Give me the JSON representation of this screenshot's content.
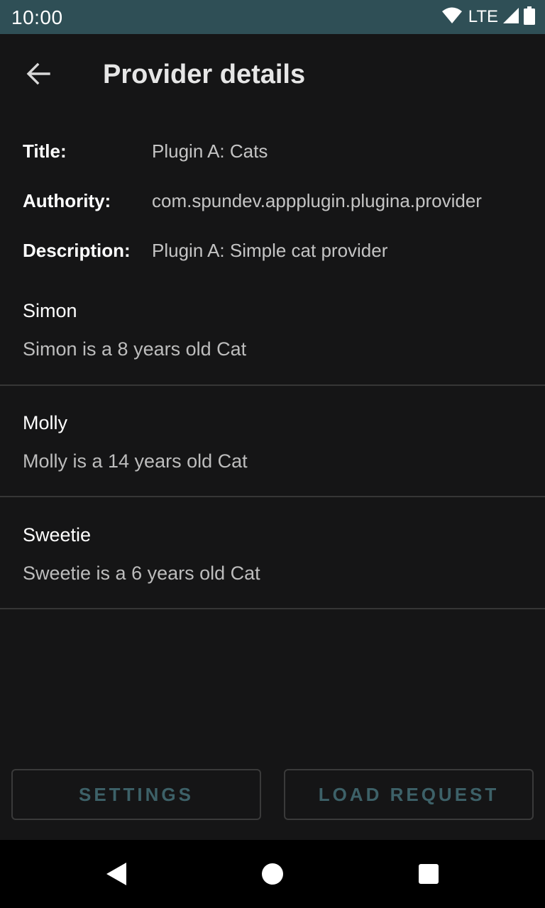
{
  "status_bar": {
    "time": "10:00",
    "network": "LTE",
    "icons": [
      "wifi-icon",
      "signal-icon",
      "battery-icon"
    ]
  },
  "app_bar": {
    "title": "Provider details",
    "back_icon": "arrow-back-icon"
  },
  "details": {
    "title_label": "Title:",
    "title_value": "Plugin A: Cats",
    "authority_label": "Authority:",
    "authority_value": "com.spundev.appplugin.plugina.provider",
    "description_label": "Description:",
    "description_value": "Plugin A: Simple cat provider"
  },
  "items": [
    {
      "name": "Simon",
      "description": "Simon is a 8 years old Cat"
    },
    {
      "name": "Molly",
      "description": "Molly is a 14 years old Cat"
    },
    {
      "name": "Sweetie",
      "description": "Sweetie is a 6 years old Cat"
    }
  ],
  "actions": {
    "settings_label": "SETTINGS",
    "load_request_label": "LOAD REQUEST"
  },
  "nav_bar": {
    "icons": [
      "back-triangle-icon",
      "home-circle-icon",
      "recents-square-icon"
    ]
  },
  "colors": {
    "status_bar": "#2f4f56",
    "background": "#151516",
    "button_text": "#3d6168",
    "divider": "#363636"
  }
}
